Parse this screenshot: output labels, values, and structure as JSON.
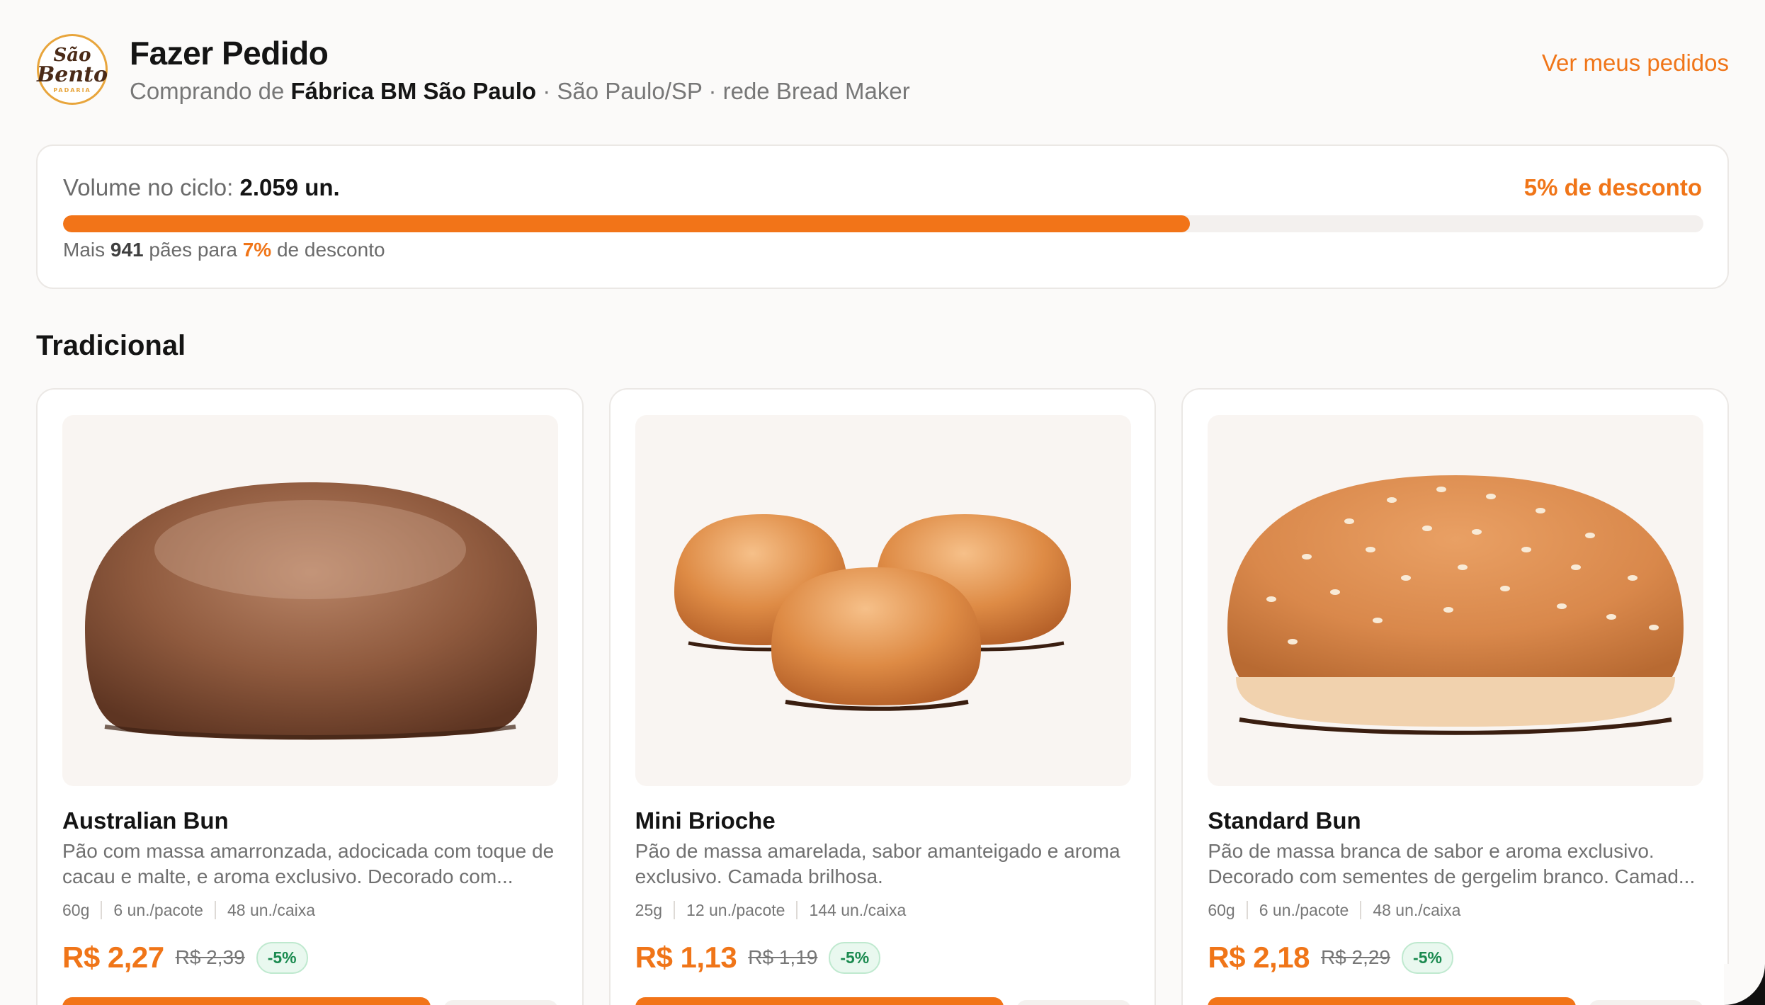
{
  "header": {
    "logo": {
      "line1": "São",
      "line2": "Bento",
      "line3": "PADARIA"
    },
    "title": "Fazer Pedido",
    "subtitle_prefix": "Comprando de ",
    "factory_name": "Fábrica BM São Paulo",
    "subtitle_suffix": " · São Paulo/SP · rede Bread Maker",
    "orders_link": "Ver meus pedidos"
  },
  "volume": {
    "label": "Volume no ciclo:",
    "value": "2.059 un.",
    "current_discount": "5% de desconto",
    "progress_fraction": 0.687,
    "hint_prefix": "Mais ",
    "hint_count": "941",
    "hint_mid": " pães para ",
    "hint_next_discount": "7%",
    "hint_suffix": " de desconto"
  },
  "section": {
    "title": "Tradicional"
  },
  "products": [
    {
      "name": "Australian Bun",
      "image_icon": "australian-bun-image",
      "description": "Pão com massa amarronzada, adocicada com toque de cacau e malte, e aroma exclusivo. Decorado com...",
      "weight": "60g",
      "per_pack": "6 un./pacote",
      "per_box": "48 un./caixa",
      "price": "R$ 2,27",
      "old_price": "R$ 2,39",
      "discount_badge": "-5%"
    },
    {
      "name": "Mini Brioche",
      "image_icon": "mini-brioche-image",
      "description": "Pão de massa amarelada, sabor amanteigado e aroma exclusivo. Camada brilhosa.",
      "weight": "25g",
      "per_pack": "12 un./pacote",
      "per_box": "144 un./caixa",
      "price": "R$ 1,13",
      "old_price": "R$ 1,19",
      "discount_badge": "-5%"
    },
    {
      "name": "Standard Bun",
      "image_icon": "standard-bun-image",
      "description": "Pão de massa branca de sabor e aroma exclusivo. Decorado com sementes de gergelim branco. Camad...",
      "weight": "60g",
      "per_pack": "6 un./pacote",
      "per_box": "48 un./caixa",
      "price": "R$ 2,18",
      "old_price": "R$ 2,29",
      "discount_badge": "-5%"
    }
  ],
  "colors": {
    "accent": "#f27418",
    "success": "#1a8a4f",
    "background": "#fbfaf9"
  }
}
